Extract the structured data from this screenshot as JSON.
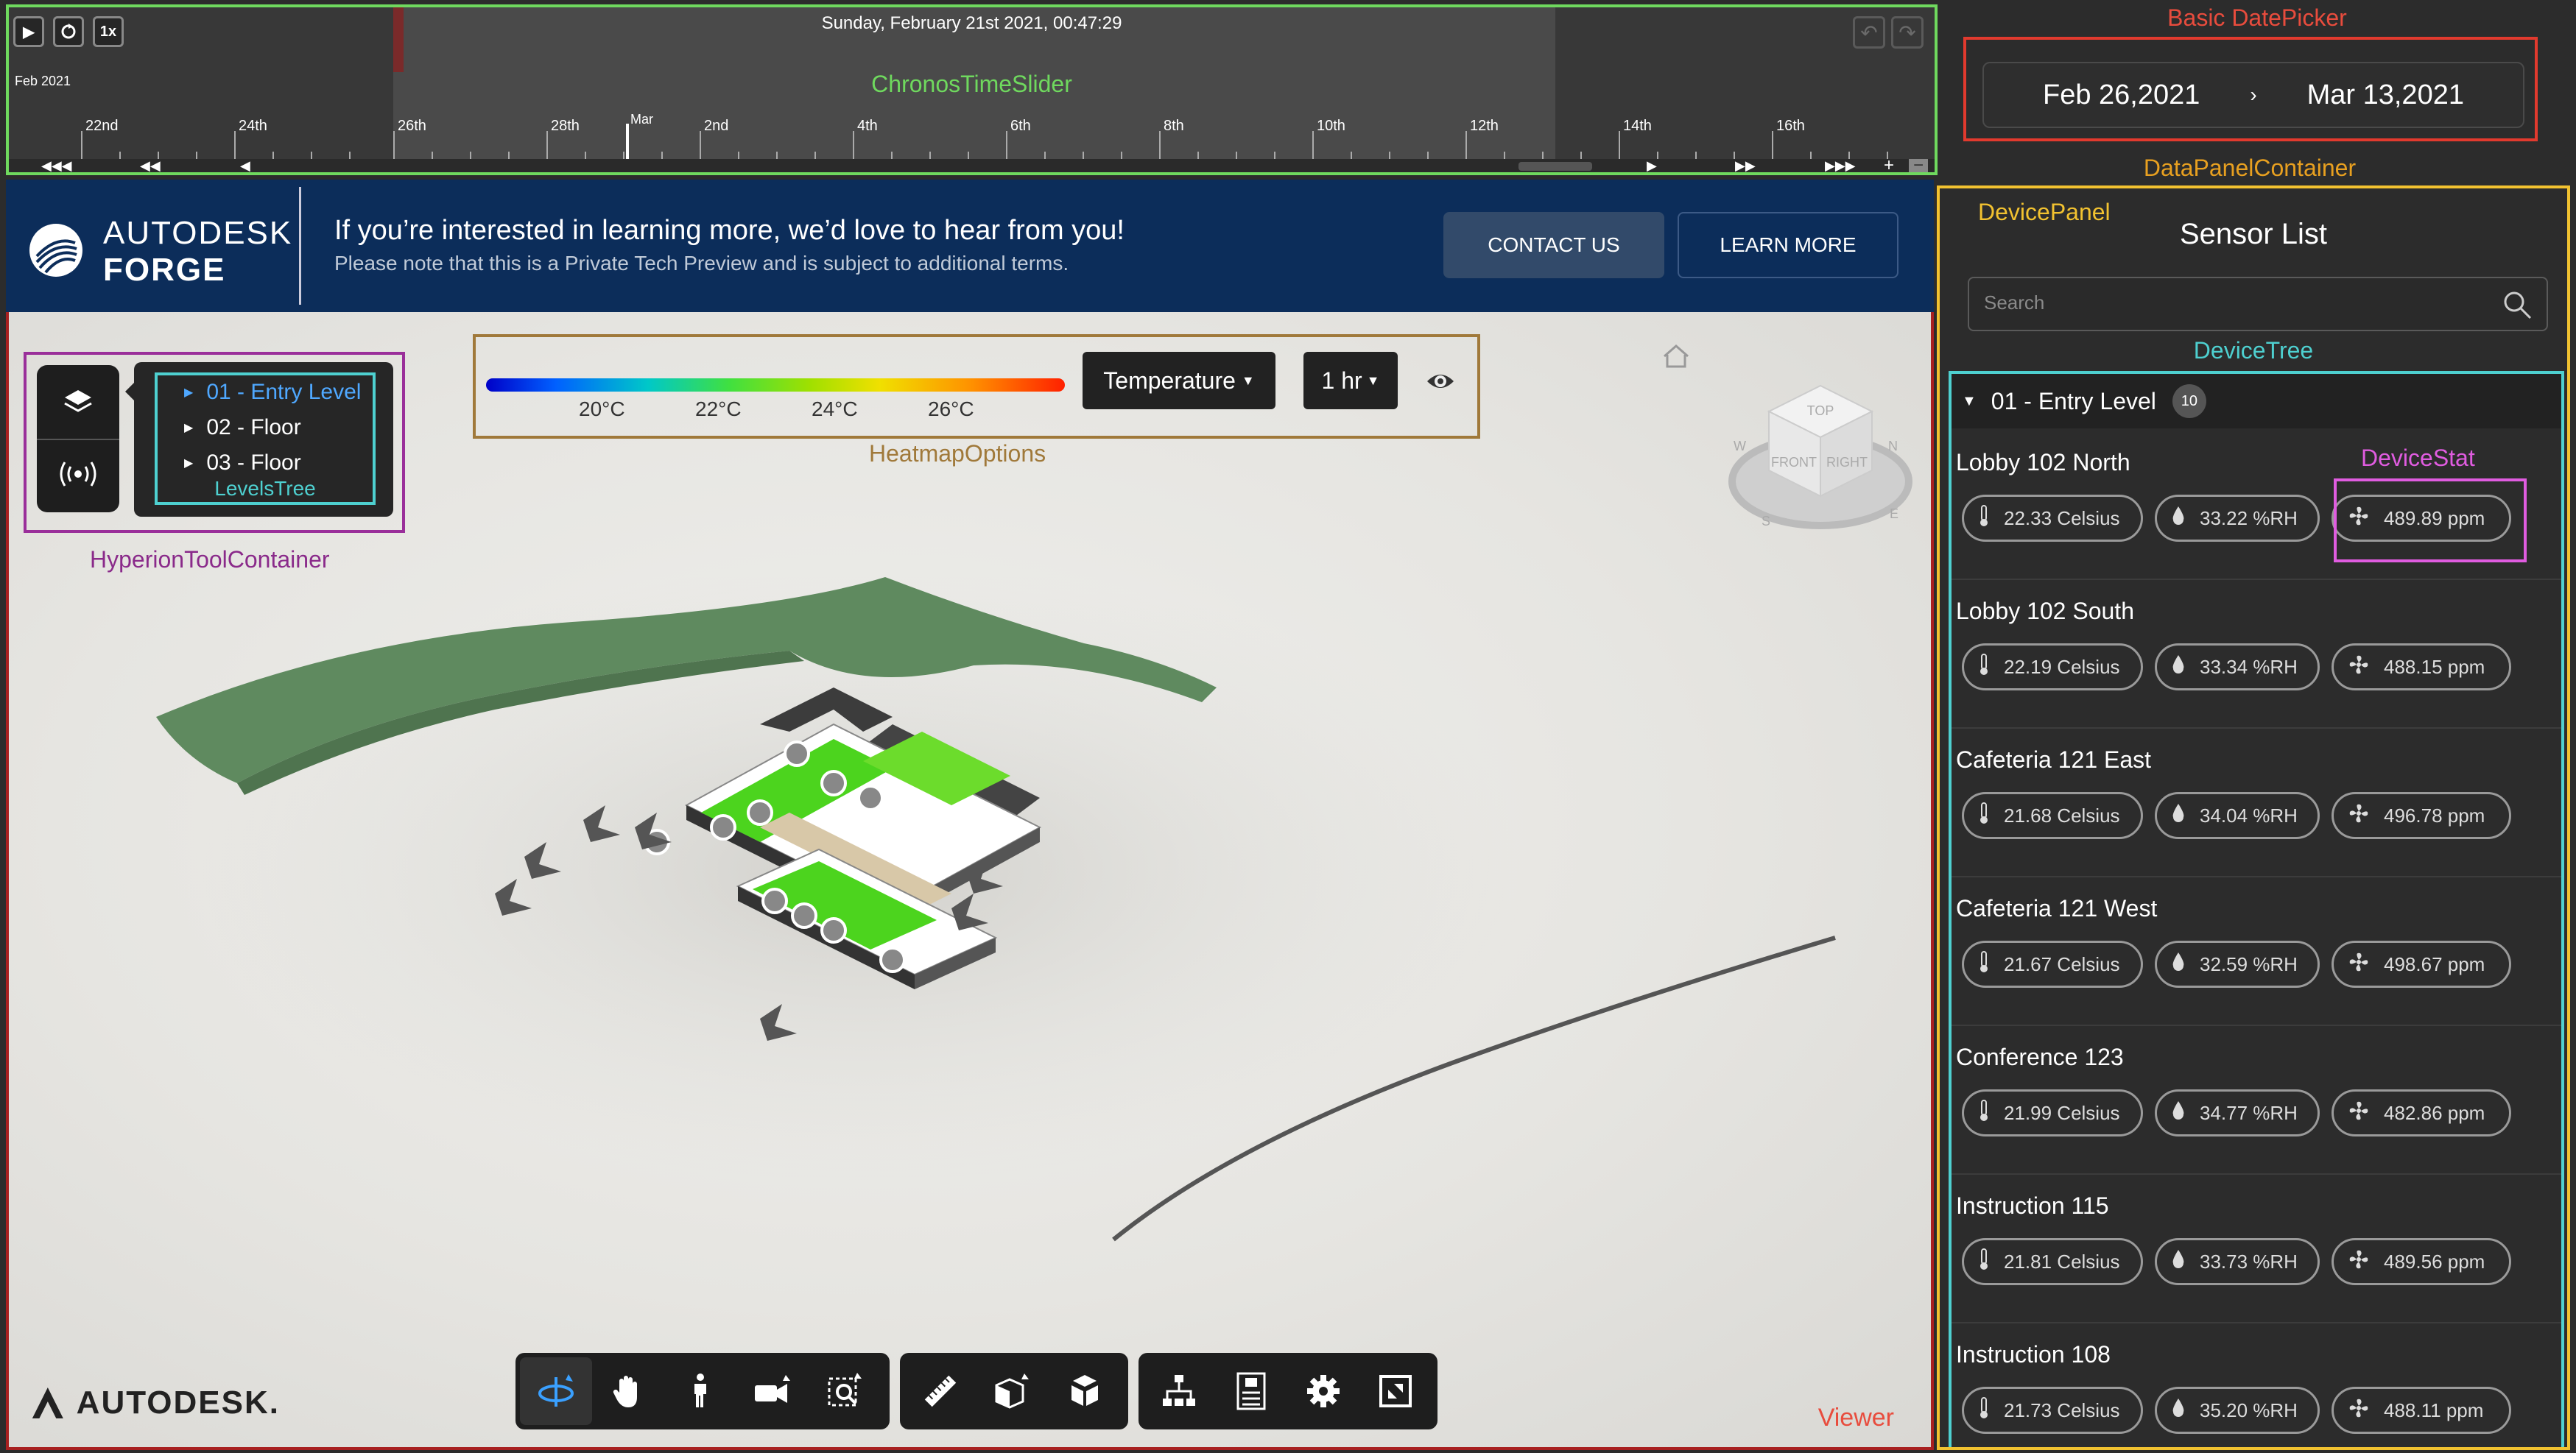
{
  "timeline": {
    "date": "Sunday, February 21st 2021, 00:47:29",
    "speed": "1x",
    "month_label": "Feb 2021",
    "annotation": "ChronosTimeSlider",
    "ticks": [
      "22nd",
      "24th",
      "26th",
      "28th",
      "2nd",
      "4th",
      "6th",
      "8th",
      "10th",
      "12th",
      "14th",
      "16th"
    ],
    "month_marker": "Mar",
    "controls": [
      "◀◀◀",
      "◀◀",
      "◀",
      "▶",
      "▶▶",
      "▶▶▶",
      "+",
      "−"
    ]
  },
  "datepicker": {
    "annotation": "Basic DatePicker",
    "start": "Feb 26,2021",
    "separator": "›",
    "end": "Mar 13,2021"
  },
  "banner": {
    "brand_top": "AUTODESK",
    "brand_bottom": "FORGE",
    "headline": "If you’re interested in learning more, we’d love to hear from you!",
    "note": "Please note that this is a Private Tech Preview and is subject to additional terms.",
    "contact_label": "CONTACT US",
    "learn_label": "LEARN MORE"
  },
  "hyperion": {
    "annotation": "HyperionToolContainer",
    "levels_annotation": "LevelsTree",
    "levels": [
      "01 - Entry Level",
      "02 - Floor",
      "03 - Floor"
    ]
  },
  "heatmap": {
    "annotation": "HeatmapOptions",
    "scale_labels": [
      "20°C",
      "22°C",
      "24°C",
      "26°C"
    ],
    "metric": "Temperature",
    "window": "1 hr"
  },
  "viewer": {
    "annotation": "Viewer",
    "logo_text": "AUTODESK.",
    "viewcube_labels": [
      "TOP",
      "FRONT",
      "RIGHT",
      "N",
      "S",
      "E",
      "W"
    ]
  },
  "panel": {
    "container_annotation": "DataPanelContainer",
    "panel_annotation": "DevicePanel",
    "title": "Sensor List",
    "search_placeholder": "Search",
    "tree_annotation": "DeviceTree",
    "stat_annotation": "DeviceStat",
    "group": {
      "name": "01 - Entry Level",
      "count": "10"
    },
    "devices": [
      {
        "name": "Lobby 102 North",
        "temp": "22.33 Celsius",
        "humidity": "33.22 %RH",
        "co2": "489.89 ppm"
      },
      {
        "name": "Lobby 102 South",
        "temp": "22.19 Celsius",
        "humidity": "33.34 %RH",
        "co2": "488.15 ppm"
      },
      {
        "name": "Cafeteria 121 East",
        "temp": "21.68 Celsius",
        "humidity": "34.04 %RH",
        "co2": "496.78 ppm"
      },
      {
        "name": "Cafeteria 121 West",
        "temp": "21.67 Celsius",
        "humidity": "32.59 %RH",
        "co2": "498.67 ppm"
      },
      {
        "name": "Conference 123",
        "temp": "21.99 Celsius",
        "humidity": "34.77 %RH",
        "co2": "482.86 ppm"
      },
      {
        "name": "Instruction 115",
        "temp": "21.81 Celsius",
        "humidity": "33.73 %RH",
        "co2": "489.56 ppm"
      },
      {
        "name": "Instruction 108",
        "temp": "21.73 Celsius",
        "humidity": "35.20 %RH",
        "co2": "488.11 ppm"
      }
    ]
  },
  "colors": {
    "timeline_border": "#6fd95e",
    "datepicker_border": "#e23a2e",
    "panel_border": "#f2c230",
    "tree_border": "#4ed0d0",
    "stat_border": "#e05ce0",
    "hyperion_border": "#9a2f9a",
    "heatmap_border": "#a0793a",
    "viewer_border": "#a82020",
    "banner_bg": "#0c2d5a",
    "active_level": "#4fa8ff"
  }
}
